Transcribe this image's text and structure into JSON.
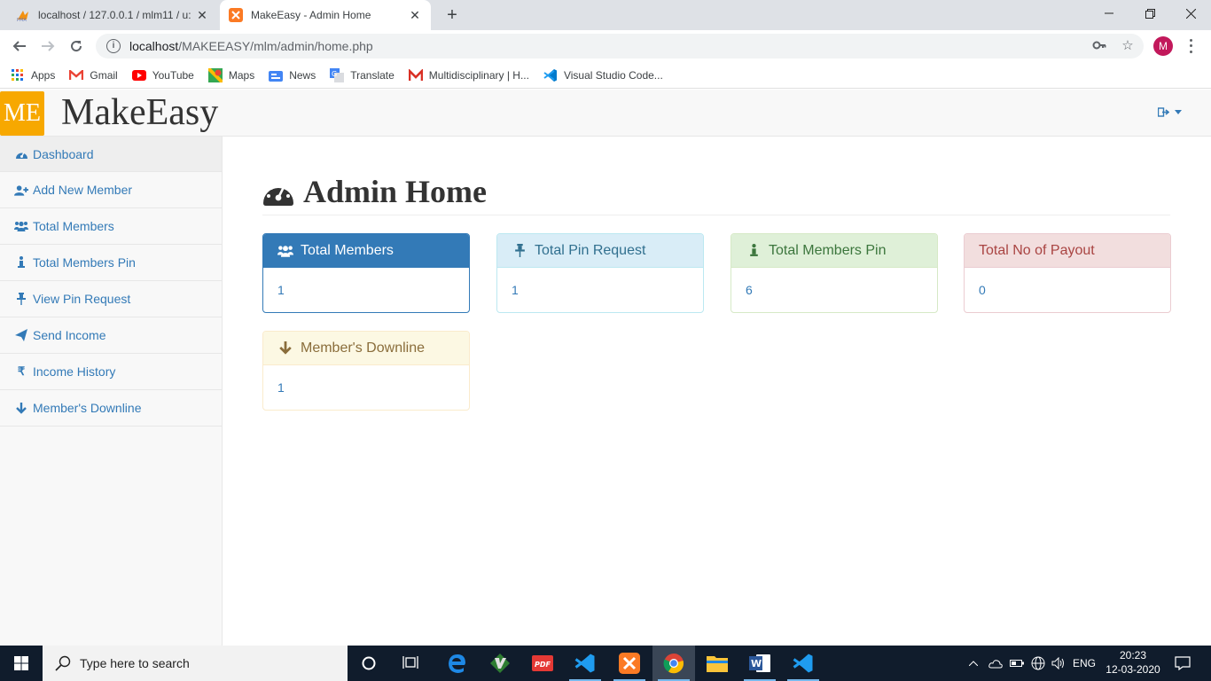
{
  "browser": {
    "tabs": [
      {
        "title": "localhost / 127.0.0.1 / mlm11 / u:",
        "active": false,
        "icon": "phpmyadmin-icon"
      },
      {
        "title": "MakeEasy - Admin Home",
        "active": true,
        "icon": "xampp-icon"
      }
    ],
    "url_host": "localhost",
    "url_path": "/MAKEEASY/mlm/admin/home.php",
    "profile_initial": "M",
    "bookmarks": [
      {
        "label": "Apps",
        "icon": "apps-grid-icon"
      },
      {
        "label": "Gmail",
        "icon": "gmail-icon"
      },
      {
        "label": "YouTube",
        "icon": "youtube-icon"
      },
      {
        "label": "Maps",
        "icon": "maps-icon"
      },
      {
        "label": "News",
        "icon": "news-icon"
      },
      {
        "label": "Translate",
        "icon": "translate-icon"
      },
      {
        "label": "Multidisciplinary | H...",
        "icon": "m-logo-icon"
      },
      {
        "label": "Visual Studio Code...",
        "icon": "vscode-icon"
      }
    ]
  },
  "navbar": {
    "logo_text": "ME",
    "brand": "MakeEasy"
  },
  "sidebar": {
    "items": [
      {
        "label": "Dashboard",
        "icon": "dashboard-icon"
      },
      {
        "label": "Add New Member",
        "icon": "user-plus-icon"
      },
      {
        "label": "Total Members",
        "icon": "users-icon"
      },
      {
        "label": "Total Members Pin",
        "icon": "male-icon"
      },
      {
        "label": "View Pin Request",
        "icon": "pin-icon"
      },
      {
        "label": "Send Income",
        "icon": "send-icon"
      },
      {
        "label": "Income History",
        "icon": "rupee-icon"
      },
      {
        "label": "Member's Downline",
        "icon": "arrow-down-icon"
      }
    ]
  },
  "page": {
    "title": "Admin Home",
    "panels": [
      {
        "title": "Total Members",
        "value": "1",
        "style": "primary",
        "icon": "users-icon"
      },
      {
        "title": "Total Pin Request",
        "value": "1",
        "style": "info",
        "icon": "pin-icon"
      },
      {
        "title": "Total Members Pin",
        "value": "6",
        "style": "success",
        "icon": "male-icon"
      },
      {
        "title": "Total No of Payout",
        "value": "0",
        "style": "danger",
        "icon": ""
      },
      {
        "title": "Member's Downline",
        "value": "1",
        "style": "warning",
        "icon": "arrow-down-icon"
      }
    ]
  },
  "taskbar": {
    "search_placeholder": "Type here to search",
    "language": "ENG",
    "time": "20:23",
    "date": "12-03-2020"
  },
  "colors": {
    "brand_orange": "#f7a800",
    "link_blue": "#337ab7",
    "taskbar_bg": "#101c2c"
  }
}
